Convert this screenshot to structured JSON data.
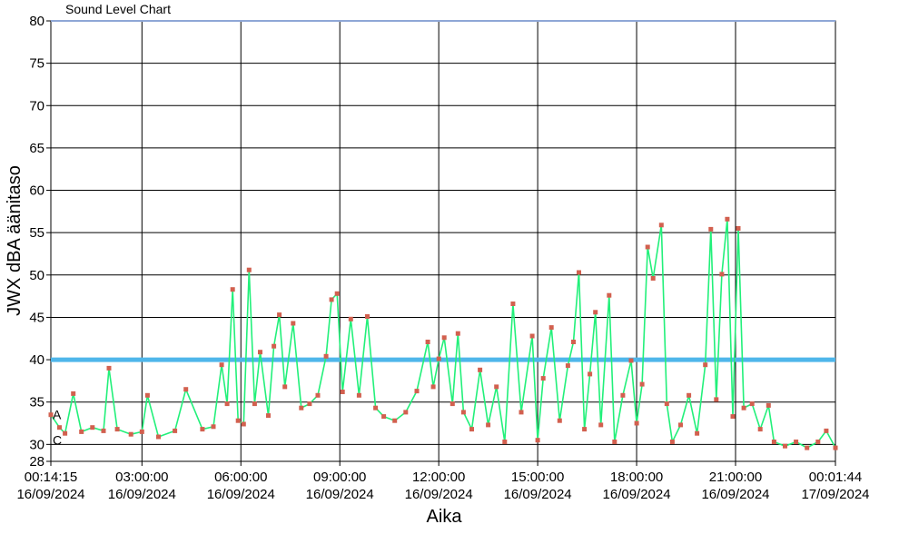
{
  "chart_data": {
    "type": "line",
    "title": "Sound Level Chart",
    "xlabel": "Aika",
    "ylabel": "JWX dBA äänitaso",
    "ylim": [
      28,
      80
    ],
    "yticks": [
      28,
      30,
      35,
      40,
      45,
      50,
      55,
      60,
      65,
      70,
      75,
      80
    ],
    "xlim": [
      "2024-09-16 00:14:15",
      "2024-09-17 00:01:44"
    ],
    "xticks": [
      {
        "time": "2024-09-16 00:14:15",
        "label": "00:14:15",
        "date": "16/09/2024"
      },
      {
        "time": "2024-09-16 03:00:00",
        "label": "03:00:00",
        "date": "16/09/2024"
      },
      {
        "time": "2024-09-16 06:00:00",
        "label": "06:00:00",
        "date": "16/09/2024"
      },
      {
        "time": "2024-09-16 09:00:00",
        "label": "09:00:00",
        "date": "16/09/2024"
      },
      {
        "time": "2024-09-16 12:00:00",
        "label": "12:00:00",
        "date": "16/09/2024"
      },
      {
        "time": "2024-09-16 15:00:00",
        "label": "15:00:00",
        "date": "16/09/2024"
      },
      {
        "time": "2024-09-16 18:00:00",
        "label": "18:00:00",
        "date": "16/09/2024"
      },
      {
        "time": "2024-09-16 21:00:00",
        "label": "21:00:00",
        "date": "16/09/2024"
      },
      {
        "time": "2024-09-17 00:01:44",
        "label": "00:01:44",
        "date": "17/09/2024"
      }
    ],
    "grid": true,
    "threshold": {
      "value": 40,
      "color": "#4fb6ea"
    },
    "markers": [
      {
        "label": "A",
        "value": 33.5
      },
      {
        "label": "C",
        "value": 30.5
      }
    ],
    "series": [
      {
        "line_color": "#22f07a",
        "point_color": "#d2604f",
        "points": [
          [
            "2024-09-16 00:14:15",
            33.5
          ],
          [
            "2024-09-16 00:30:00",
            32.0
          ],
          [
            "2024-09-16 00:40:00",
            31.3
          ],
          [
            "2024-09-16 00:55:00",
            36.0
          ],
          [
            "2024-09-16 01:10:00",
            31.5
          ],
          [
            "2024-09-16 01:30:00",
            32.0
          ],
          [
            "2024-09-16 01:50:00",
            31.6
          ],
          [
            "2024-09-16 02:00:00",
            39.0
          ],
          [
            "2024-09-16 02:15:00",
            31.8
          ],
          [
            "2024-09-16 02:40:00",
            31.2
          ],
          [
            "2024-09-16 03:00:00",
            31.5
          ],
          [
            "2024-09-16 03:10:00",
            35.8
          ],
          [
            "2024-09-16 03:30:00",
            30.9
          ],
          [
            "2024-09-16 04:00:00",
            31.6
          ],
          [
            "2024-09-16 04:20:00",
            36.5
          ],
          [
            "2024-09-16 04:50:00",
            31.8
          ],
          [
            "2024-09-16 05:10:00",
            32.1
          ],
          [
            "2024-09-16 05:25:00",
            39.4
          ],
          [
            "2024-09-16 05:35:00",
            34.8
          ],
          [
            "2024-09-16 05:45:00",
            48.3
          ],
          [
            "2024-09-16 05:55:00",
            32.8
          ],
          [
            "2024-09-16 06:05:00",
            32.4
          ],
          [
            "2024-09-16 06:15:00",
            50.6
          ],
          [
            "2024-09-16 06:25:00",
            34.8
          ],
          [
            "2024-09-16 06:35:00",
            40.9
          ],
          [
            "2024-09-16 06:50:00",
            33.4
          ],
          [
            "2024-09-16 07:00:00",
            41.6
          ],
          [
            "2024-09-16 07:10:00",
            45.3
          ],
          [
            "2024-09-16 07:20:00",
            36.8
          ],
          [
            "2024-09-16 07:35:00",
            44.3
          ],
          [
            "2024-09-16 07:50:00",
            34.3
          ],
          [
            "2024-09-16 08:05:00",
            34.8
          ],
          [
            "2024-09-16 08:20:00",
            35.8
          ],
          [
            "2024-09-16 08:35:00",
            40.4
          ],
          [
            "2024-09-16 08:45:00",
            47.1
          ],
          [
            "2024-09-16 08:55:00",
            47.8
          ],
          [
            "2024-09-16 09:05:00",
            36.2
          ],
          [
            "2024-09-16 09:20:00",
            44.8
          ],
          [
            "2024-09-16 09:35:00",
            35.8
          ],
          [
            "2024-09-16 09:50:00",
            45.1
          ],
          [
            "2024-09-16 10:05:00",
            34.3
          ],
          [
            "2024-09-16 10:20:00",
            33.3
          ],
          [
            "2024-09-16 10:40:00",
            32.8
          ],
          [
            "2024-09-16 11:00:00",
            33.8
          ],
          [
            "2024-09-16 11:20:00",
            36.3
          ],
          [
            "2024-09-16 11:40:00",
            42.1
          ],
          [
            "2024-09-16 11:50:00",
            36.8
          ],
          [
            "2024-09-16 12:00:00",
            40.1
          ],
          [
            "2024-09-16 12:10:00",
            42.6
          ],
          [
            "2024-09-16 12:25:00",
            34.8
          ],
          [
            "2024-09-16 12:35:00",
            43.1
          ],
          [
            "2024-09-16 12:45:00",
            33.8
          ],
          [
            "2024-09-16 13:00:00",
            31.8
          ],
          [
            "2024-09-16 13:15:00",
            38.8
          ],
          [
            "2024-09-16 13:30:00",
            32.3
          ],
          [
            "2024-09-16 13:45:00",
            36.8
          ],
          [
            "2024-09-16 14:00:00",
            30.3
          ],
          [
            "2024-09-16 14:15:00",
            46.6
          ],
          [
            "2024-09-16 14:30:00",
            33.8
          ],
          [
            "2024-09-16 14:50:00",
            42.8
          ],
          [
            "2024-09-16 15:00:00",
            30.5
          ],
          [
            "2024-09-16 15:10:00",
            37.8
          ],
          [
            "2024-09-16 15:25:00",
            43.8
          ],
          [
            "2024-09-16 15:40:00",
            32.8
          ],
          [
            "2024-09-16 15:55:00",
            39.3
          ],
          [
            "2024-09-16 16:05:00",
            42.1
          ],
          [
            "2024-09-16 16:15:00",
            50.3
          ],
          [
            "2024-09-16 16:25:00",
            31.8
          ],
          [
            "2024-09-16 16:35:00",
            38.3
          ],
          [
            "2024-09-16 16:45:00",
            45.6
          ],
          [
            "2024-09-16 16:55:00",
            32.3
          ],
          [
            "2024-09-16 17:10:00",
            47.6
          ],
          [
            "2024-09-16 17:20:00",
            30.3
          ],
          [
            "2024-09-16 17:35:00",
            35.8
          ],
          [
            "2024-09-16 17:50:00",
            39.9
          ],
          [
            "2024-09-16 18:00:00",
            32.5
          ],
          [
            "2024-09-16 18:10:00",
            37.1
          ],
          [
            "2024-09-16 18:20:00",
            53.3
          ],
          [
            "2024-09-16 18:30:00",
            49.6
          ],
          [
            "2024-09-16 18:45:00",
            55.9
          ],
          [
            "2024-09-16 18:55:00",
            34.8
          ],
          [
            "2024-09-16 19:05:00",
            30.3
          ],
          [
            "2024-09-16 19:20:00",
            32.3
          ],
          [
            "2024-09-16 19:35:00",
            35.8
          ],
          [
            "2024-09-16 19:50:00",
            31.3
          ],
          [
            "2024-09-16 20:05:00",
            39.4
          ],
          [
            "2024-09-16 20:15:00",
            55.4
          ],
          [
            "2024-09-16 20:25:00",
            35.3
          ],
          [
            "2024-09-16 20:35:00",
            50.1
          ],
          [
            "2024-09-16 20:45:00",
            56.6
          ],
          [
            "2024-09-16 20:55:00",
            33.3
          ],
          [
            "2024-09-16 21:05:00",
            55.5
          ],
          [
            "2024-09-16 21:15:00",
            34.3
          ],
          [
            "2024-09-16 21:30:00",
            34.8
          ],
          [
            "2024-09-16 21:45:00",
            31.8
          ],
          [
            "2024-09-16 22:00:00",
            34.6
          ],
          [
            "2024-09-16 22:10:00",
            30.3
          ],
          [
            "2024-09-16 22:30:00",
            29.8
          ],
          [
            "2024-09-16 22:50:00",
            30.3
          ],
          [
            "2024-09-16 23:10:00",
            29.6
          ],
          [
            "2024-09-16 23:30:00",
            30.3
          ],
          [
            "2024-09-16 23:45:00",
            31.6
          ],
          [
            "2024-09-17 00:01:44",
            29.6
          ]
        ]
      }
    ]
  }
}
